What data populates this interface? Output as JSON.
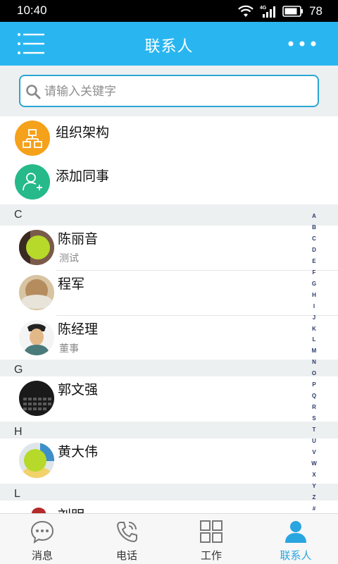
{
  "status_bar": {
    "time": "10:40",
    "battery": "78",
    "signal_label": "4G"
  },
  "header": {
    "title": "联系人",
    "menu_icon": "list-menu-icon",
    "more_icon": "more-dots-icon"
  },
  "search": {
    "placeholder": "请输入关键字",
    "value": ""
  },
  "functions": [
    {
      "label": "组织架构",
      "icon": "org-structure-icon",
      "color": "#f5a11a"
    },
    {
      "label": "添加同事",
      "icon": "add-user-icon",
      "color": "#26b98a"
    }
  ],
  "sections": [
    {
      "letter": "C",
      "contacts": [
        {
          "name": "陈丽音",
          "title": "测试"
        },
        {
          "name": "程军",
          "title": ""
        },
        {
          "name": "陈经理",
          "title": "董事"
        }
      ]
    },
    {
      "letter": "G",
      "contacts": [
        {
          "name": "郭文强",
          "title": ""
        }
      ]
    },
    {
      "letter": "H",
      "contacts": [
        {
          "name": "黄大伟",
          "title": ""
        }
      ]
    },
    {
      "letter": "L",
      "contacts": [
        {
          "name": "刘明",
          "title": ""
        }
      ]
    }
  ],
  "index_letters": [
    "A",
    "B",
    "C",
    "D",
    "E",
    "F",
    "G",
    "H",
    "I",
    "J",
    "K",
    "L",
    "M",
    "N",
    "O",
    "P",
    "Q",
    "R",
    "S",
    "T",
    "U",
    "V",
    "W",
    "X",
    "Y",
    "Z",
    "#"
  ],
  "bottom_nav": [
    {
      "label": "消息",
      "icon": "chat-bubble-icon",
      "active": false
    },
    {
      "label": "电话",
      "icon": "phone-icon",
      "active": false
    },
    {
      "label": "工作",
      "icon": "grid-apps-icon",
      "active": false
    },
    {
      "label": "联系人",
      "icon": "contacts-person-icon",
      "active": true
    }
  ],
  "colors": {
    "primary": "#29b6f0",
    "accent": "#29a6e0",
    "section_bg": "#edf0f1"
  }
}
